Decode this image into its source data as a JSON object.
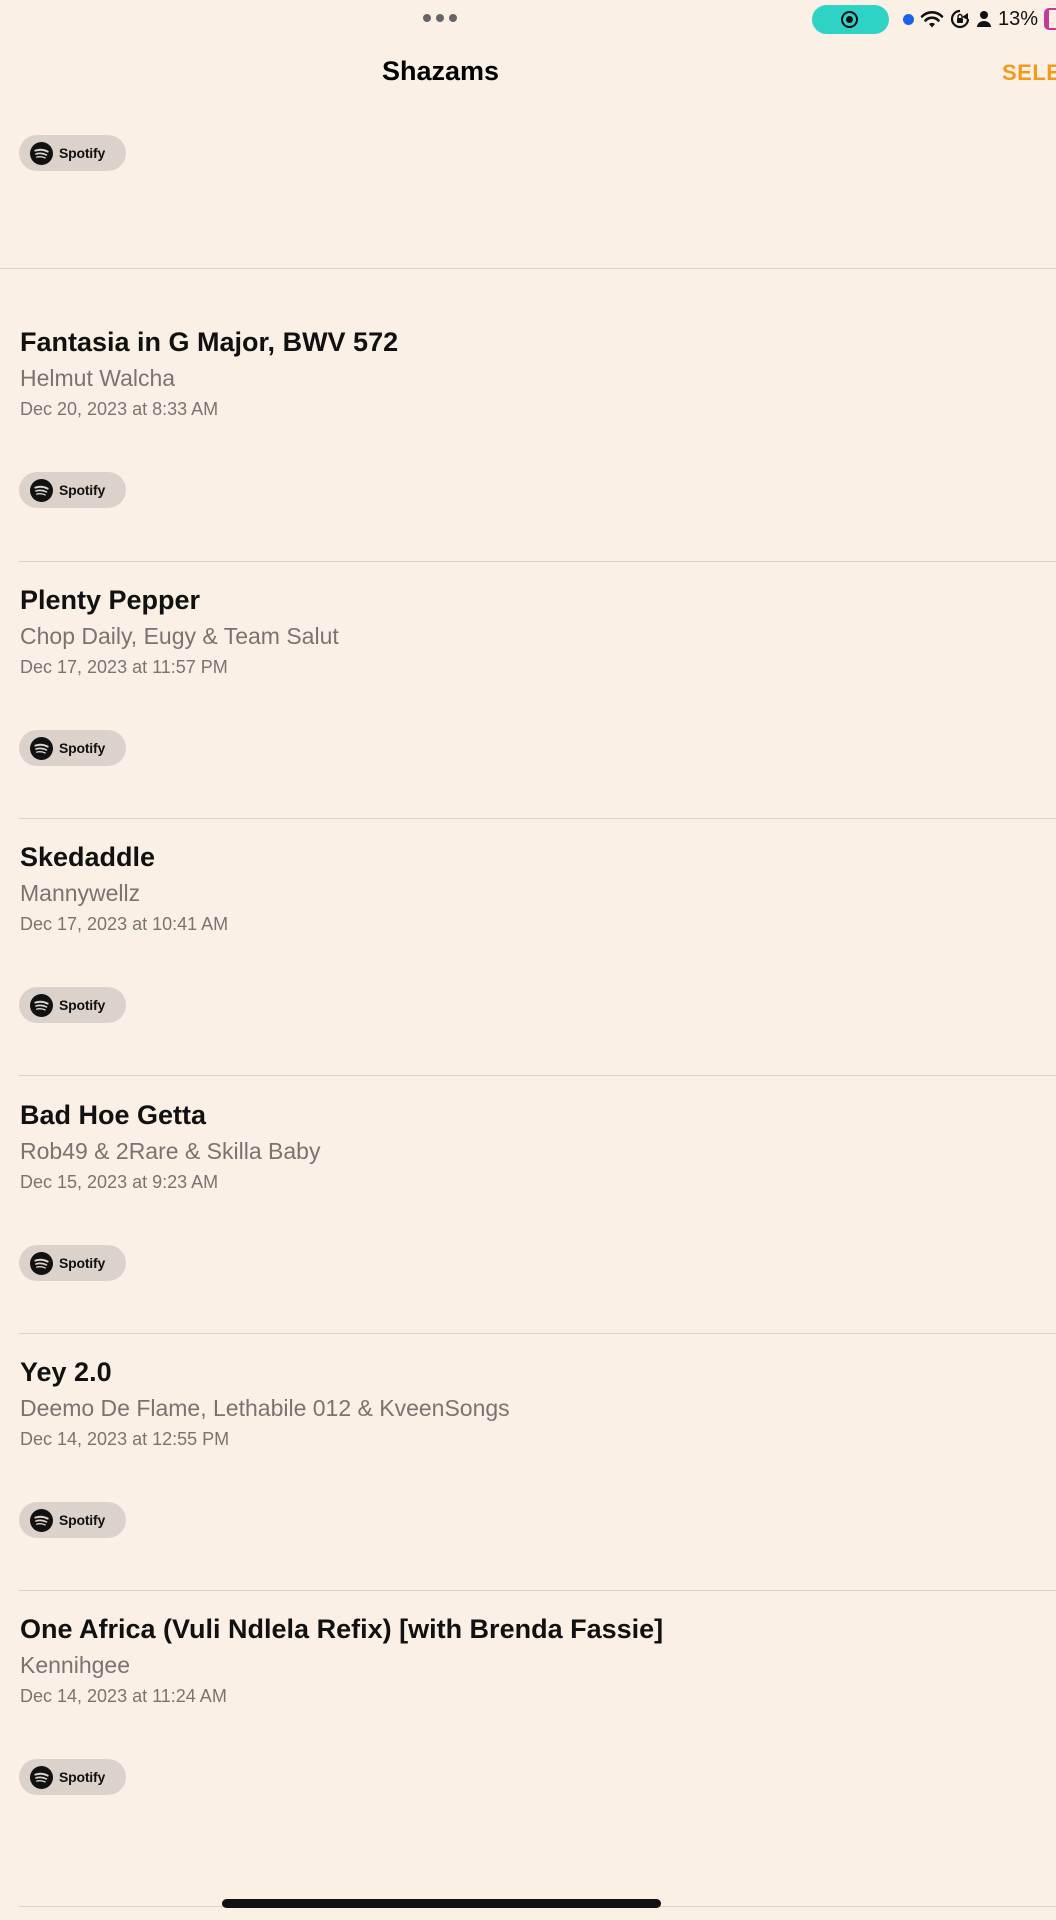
{
  "status_bar": {
    "battery_percent": "13%",
    "icons": [
      "multitask-dots-icon",
      "screen-record-icon",
      "location-dot-icon",
      "wifi-icon",
      "orientation-lock-icon",
      "person-icon",
      "battery-icon"
    ]
  },
  "nav": {
    "title": "Shazams",
    "select_label": "SELE"
  },
  "spotify_label": "Spotify",
  "tracks": [
    {
      "title": "Fantasia in G Major, BWV 572",
      "artist": "Helmut Walcha",
      "date": "Dec 20, 2023 at 8:33 AM"
    },
    {
      "title": "Plenty Pepper",
      "artist": "Chop Daily, Eugy & Team Salut",
      "date": "Dec 17, 2023 at 11:57 PM"
    },
    {
      "title": "Skedaddle",
      "artist": "Mannywellz",
      "date": "Dec 17, 2023 at 10:41 AM"
    },
    {
      "title": "Bad Hoe Getta",
      "artist": "Rob49 & 2Rare & Skilla Baby",
      "date": "Dec 15, 2023 at 9:23 AM"
    },
    {
      "title": "Yey 2.0",
      "artist": "Deemo De Flame, Lethabile 012 & KveenSongs",
      "date": "Dec 14, 2023 at 12:55 PM"
    },
    {
      "title": "One Africa (Vuli Ndlela Refix) [with Brenda Fassie]",
      "artist": "Kennihgee",
      "date": "Dec 14, 2023 at 11:24 AM"
    }
  ],
  "colors": {
    "background": "#faf0e6",
    "accent": "#f29a1d",
    "record_pill": "#2fd3c6",
    "secondary_text": "#7a7470"
  }
}
